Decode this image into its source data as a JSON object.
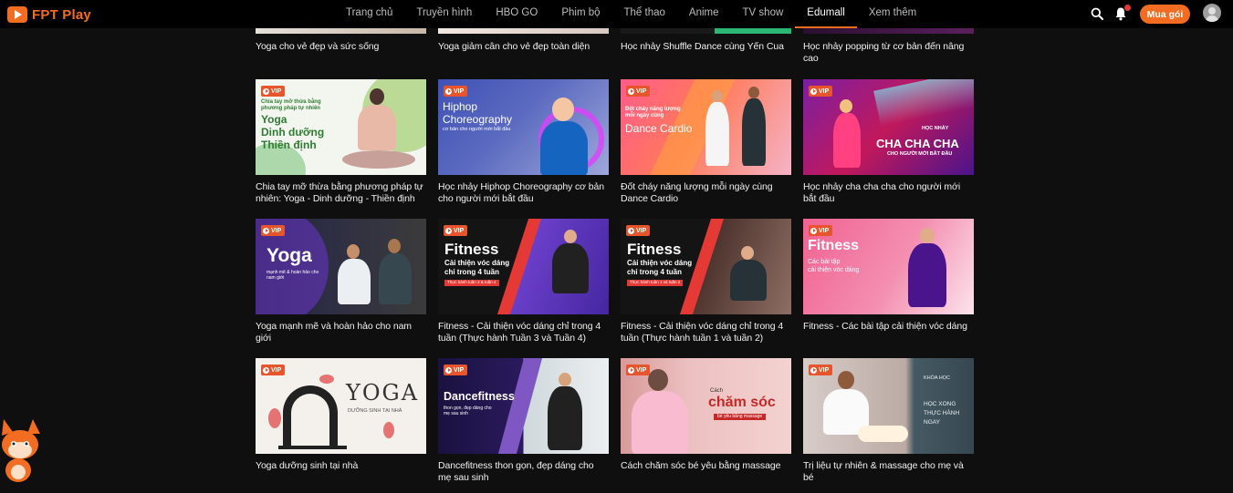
{
  "brand": {
    "name": "FPT Play",
    "color": "#f26d21"
  },
  "nav": {
    "items": [
      "Trang chủ",
      "Truyền hình",
      "HBO GO",
      "Phim bộ",
      "Thể thao",
      "Anime",
      "TV show",
      "Edumall",
      "Xem thêm"
    ],
    "active": "Edumall"
  },
  "actions": {
    "search_icon": "search-icon",
    "bell_icon": "bell-icon",
    "buy_label": "Mua gói",
    "avatar_icon": "user-avatar"
  },
  "badge_label": "VIP",
  "rows": [
    {
      "cards": [
        {
          "title": "Yoga cho vẻ đẹp và sức sống"
        },
        {
          "title": "Yoga giảm cân cho vẻ đẹp toàn diện"
        },
        {
          "title": "Học nhảy Shuffle Dance cùng Yến Cua"
        },
        {
          "title": "Học nhảy popping từ cơ bản đến nâng cao"
        }
      ]
    },
    {
      "cards": [
        {
          "title": "Chia tay mỡ thừa bằng phương pháp tự nhiên: Yoga - Dinh dưỡng - Thiền định",
          "thumb": {
            "small": "Chia tay mỡ thừa bằng phương pháp tự nhiên",
            "line1": "Yoga",
            "line2": "Dinh dưỡng",
            "line3": "Thiền định"
          }
        },
        {
          "title": "Học nhảy Hiphop Choreography cơ bản cho người mới bắt đầu",
          "thumb": {
            "line1": "Hiphop",
            "line2": "Choreography",
            "small": "cơ bản cho người mới bắt đầu"
          }
        },
        {
          "title": "Đốt cháy năng lượng mỗi ngày cùng Dance Cardio",
          "thumb": {
            "small": "Đốt cháy năng lượng mỗi ngày cùng",
            "line1": "Dance Cardio"
          }
        },
        {
          "title": "Học nhảy cha cha cha cho người mới bắt đầu",
          "thumb": {
            "small": "HỌC NHẢY",
            "line1": "CHA CHA CHA",
            "line2": "CHO NGƯỜI MỚI BẮT ĐẦU"
          }
        }
      ]
    },
    {
      "cards": [
        {
          "title": "Yoga mạnh mẽ và hoàn hảo cho nam giới",
          "thumb": {
            "line1": "Yoga",
            "small": "mạnh mẽ & hoàn hảo cho nam giới"
          }
        },
        {
          "title": "Fitness - Cải thiện vóc dáng chỉ trong 4 tuần (Thực hành Tuần 3 và Tuần 4)",
          "thumb": {
            "line1": "Fitness",
            "line2": "Cải thiện vóc dáng",
            "line3": "chỉ trong 4 tuần",
            "small": "Thực hành tuần 3 & tuần 4"
          }
        },
        {
          "title": "Fitness - Cải thiện vóc dáng chỉ trong 4 tuần (Thực hành tuần 1 và tuần 2)",
          "thumb": {
            "line1": "Fitness",
            "line2": "Cải thiện vóc dáng",
            "line3": "chỉ trong 4 tuần",
            "small": "Thực hành tuần 1 và tuần 2"
          }
        },
        {
          "title": "Fitness - Các bài tập cải thiện vóc dáng",
          "thumb": {
            "line1": "Fitness",
            "line2": "Các bài tập",
            "line3": "cải thiện vóc dáng"
          }
        }
      ]
    },
    {
      "cards": [
        {
          "title": "Yoga dưỡng sinh tại nhà",
          "thumb": {
            "line1": "YOGA",
            "small": "DƯỠNG SINH TẠI NHÀ"
          }
        },
        {
          "title": "Dancefitness thon gọn, đẹp dáng cho mẹ sau sinh",
          "thumb": {
            "line1": "Dancefitness",
            "small": "thon gọn, đẹp dáng cho mẹ sau sinh"
          }
        },
        {
          "title": "Cách chăm sóc bé yêu bằng massage",
          "thumb": {
            "small": "Cách",
            "line1": "chăm sóc",
            "line2": "bé yêu bằng massage"
          }
        },
        {
          "title": "Trị liệu tự nhiên & massage cho mẹ và bé",
          "thumb": {
            "small": "KHÓA HỌC",
            "line1": "HỌC XONG",
            "line2": "THỰC HÀNH",
            "line3": "NGAY"
          }
        }
      ]
    }
  ]
}
